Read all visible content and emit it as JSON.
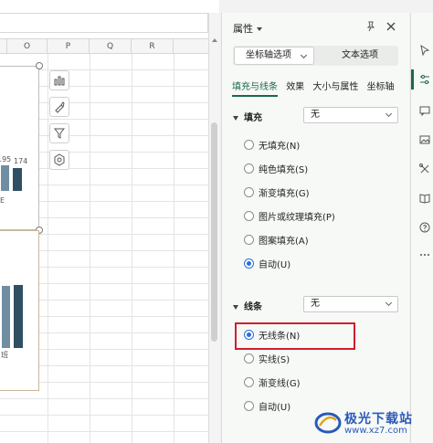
{
  "sheet": {
    "columns": [
      "O",
      "P",
      "Q",
      "R"
    ],
    "chart1": {
      "data_labels": [
        "195",
        "174"
      ],
      "axis_label": "E"
    },
    "chart2": {
      "axis_label": "班"
    }
  },
  "panel": {
    "title": "属性",
    "segments": {
      "axis_options": "坐标轴选项",
      "text_options": "文本选项"
    },
    "tabs": [
      {
        "label": "填充与线条",
        "active": true
      },
      {
        "label": "效果",
        "active": false
      },
      {
        "label": "大小与属性",
        "active": false
      },
      {
        "label": "坐标轴",
        "active": false
      }
    ],
    "fill": {
      "heading": "填充",
      "select_value": "无",
      "options": [
        {
          "label": "无填充(N)",
          "checked": false
        },
        {
          "label": "纯色填充(S)",
          "checked": false
        },
        {
          "label": "渐变填充(G)",
          "checked": false
        },
        {
          "label": "图片或纹理填充(P)",
          "checked": false
        },
        {
          "label": "图案填充(A)",
          "checked": false
        },
        {
          "label": "自动(U)",
          "checked": true
        }
      ]
    },
    "line": {
      "heading": "线条",
      "select_value": "无",
      "options": [
        {
          "label": "无线条(N)",
          "checked": true
        },
        {
          "label": "实线(S)",
          "checked": false
        },
        {
          "label": "渐变线(G)",
          "checked": false
        },
        {
          "label": "自动(U)",
          "checked": false
        }
      ]
    }
  },
  "watermark": {
    "brand": "极光下载站",
    "url": "www.xz7.com"
  },
  "colors": {
    "accent": "#1a6a48",
    "radio": "#2a6fd6",
    "highlight": "#d01f2a",
    "bar_dark": "#2f4f63",
    "bar_light": "#6f8ea1"
  }
}
